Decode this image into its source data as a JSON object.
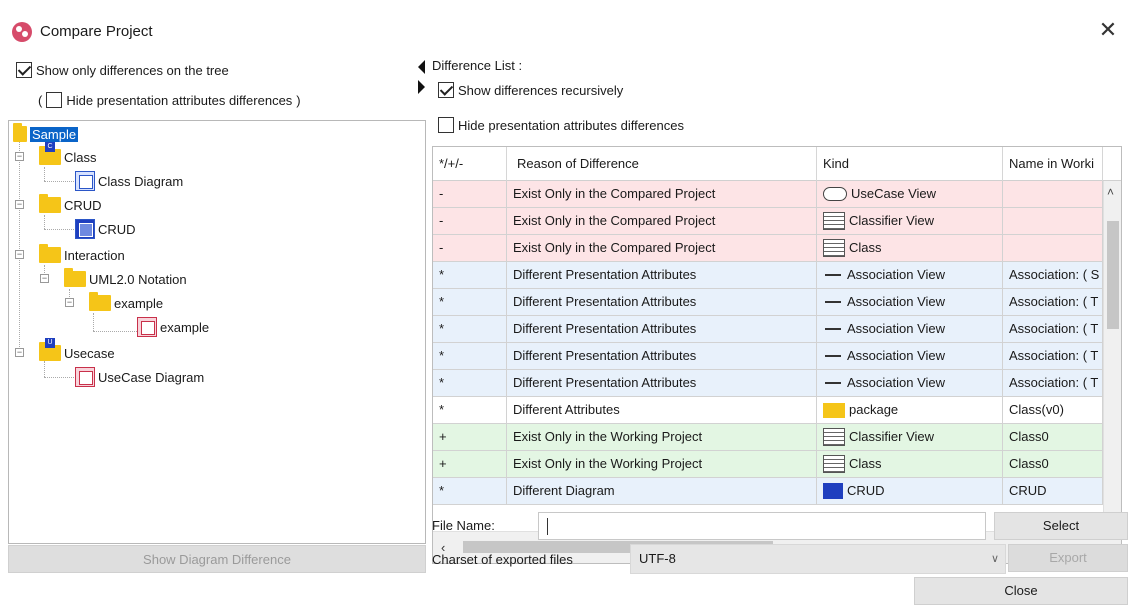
{
  "window": {
    "title": "Compare Project",
    "close_symbol": "✕"
  },
  "left": {
    "show_only_diff_label": "Show only differences on the tree",
    "hide_presentation_label": "Hide presentation attributes differences",
    "paren_open": "(",
    "paren_close": ")",
    "tree": {
      "sample": "Sample",
      "class": "Class",
      "class_diagram": "Class Diagram",
      "crud_folder": "CRUD",
      "crud_diagram": "CRUD",
      "interaction": "Interaction",
      "uml_notation": "UML2.0 Notation",
      "example_folder": "example",
      "example_diagram": "example",
      "usecase": "Usecase",
      "usecase_diagram": "UseCase Diagram"
    },
    "show_diagram_diff_button": "Show Diagram Difference"
  },
  "right": {
    "difference_list_label": "Difference List :",
    "show_recursive_label": "Show differences recursively",
    "hide_presentation_label": "Hide presentation attributes differences",
    "columns": [
      "*/+/-",
      "Reason of Difference",
      "Kind",
      "Name in Worki"
    ],
    "rows": [
      {
        "mark": "-",
        "reason": "Exist Only in the Compared Project",
        "kind": "UseCase View",
        "kind_icon": "oval-icon",
        "name": ""
      },
      {
        "mark": "-",
        "reason": "Exist Only in the Compared Project",
        "kind": "Classifier View",
        "kind_icon": "list-icon",
        "name": ""
      },
      {
        "mark": "-",
        "reason": "Exist Only in the Compared Project",
        "kind": "Class",
        "kind_icon": "list-icon",
        "name": ""
      },
      {
        "mark": "*",
        "reason": "Different Presentation Attributes",
        "kind": "Association View",
        "kind_icon": "line-icon",
        "name": "Association: ( S"
      },
      {
        "mark": "*",
        "reason": "Different Presentation Attributes",
        "kind": "Association View",
        "kind_icon": "line-icon",
        "name": "Association: ( T"
      },
      {
        "mark": "*",
        "reason": "Different Presentation Attributes",
        "kind": "Association View",
        "kind_icon": "line-icon",
        "name": "Association: ( T"
      },
      {
        "mark": "*",
        "reason": "Different Presentation Attributes",
        "kind": "Association View",
        "kind_icon": "line-icon",
        "name": "Association: ( T"
      },
      {
        "mark": "*",
        "reason": "Different Presentation Attributes",
        "kind": "Association View",
        "kind_icon": "line-icon",
        "name": "Association: ( T"
      },
      {
        "mark": "*",
        "reason": "Different Attributes",
        "kind": "package",
        "kind_icon": "folder-icon",
        "name": "Class(v0)"
      },
      {
        "mark": "+",
        "reason": "Exist Only in the Working Project",
        "kind": "Classifier View",
        "kind_icon": "list-icon",
        "name": "Class0"
      },
      {
        "mark": "+",
        "reason": "Exist Only in the Working Project",
        "kind": "Class",
        "kind_icon": "list-icon",
        "name": "Class0"
      },
      {
        "mark": "*",
        "reason": "Different Diagram",
        "kind": "CRUD",
        "kind_icon": "diagram-icon",
        "name": "CRUD"
      }
    ],
    "row_colors": {
      "minus": "#fde4e6",
      "star": "#e8f1fb",
      "plain": "#ffffff",
      "plus": "#e3f6e3"
    },
    "file_name_label": "File Name:",
    "file_name_value": "",
    "select_button": "Select",
    "charset_label": "Charset of exported files",
    "charset_value": "UTF-8",
    "export_button": "Export",
    "close_button": "Close"
  }
}
